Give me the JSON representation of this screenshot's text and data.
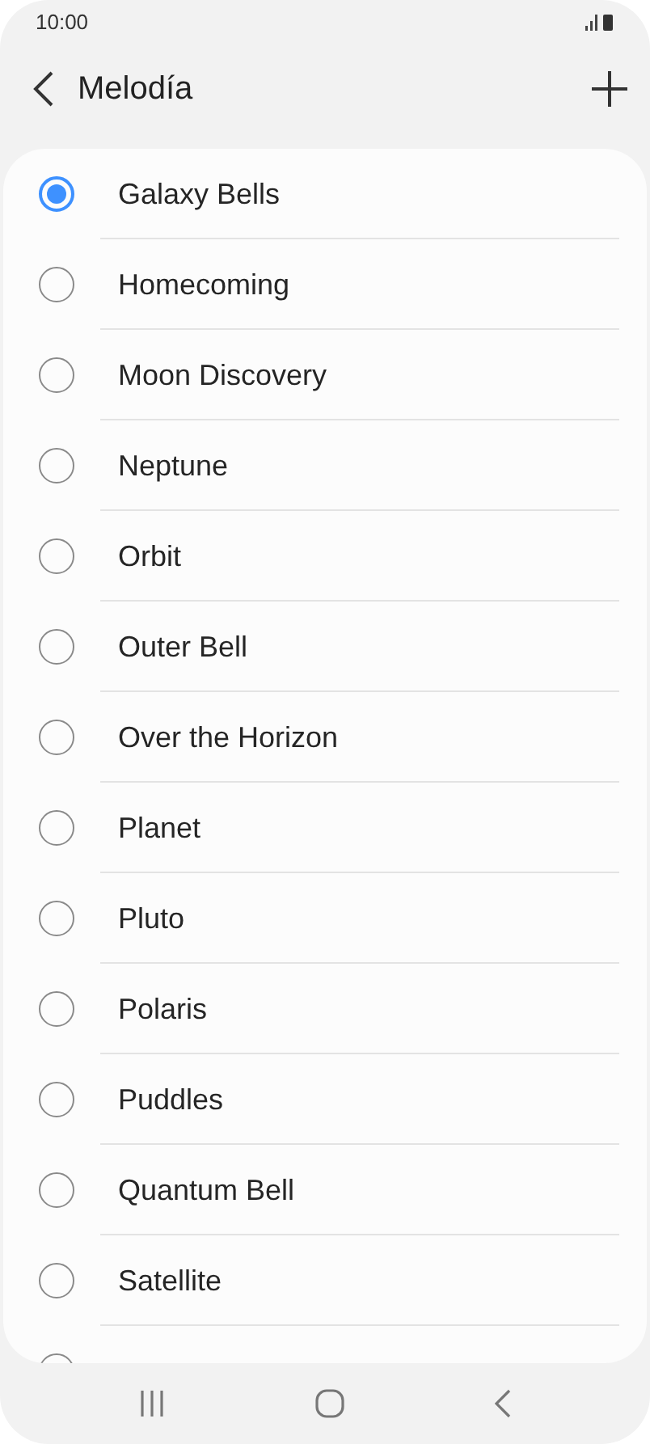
{
  "status_bar": {
    "time": "10:00"
  },
  "header": {
    "title": "Melodía"
  },
  "ringtones": [
    {
      "label": "Galaxy Bells",
      "selected": true
    },
    {
      "label": "Homecoming",
      "selected": false
    },
    {
      "label": "Moon Discovery",
      "selected": false
    },
    {
      "label": "Neptune",
      "selected": false
    },
    {
      "label": "Orbit",
      "selected": false
    },
    {
      "label": "Outer Bell",
      "selected": false
    },
    {
      "label": "Over the Horizon",
      "selected": false
    },
    {
      "label": "Planet",
      "selected": false
    },
    {
      "label": "Pluto",
      "selected": false
    },
    {
      "label": "Polaris",
      "selected": false
    },
    {
      "label": "Puddles",
      "selected": false
    },
    {
      "label": "Quantum Bell",
      "selected": false
    },
    {
      "label": "Satellite",
      "selected": false
    },
    {
      "selected": false
    }
  ]
}
